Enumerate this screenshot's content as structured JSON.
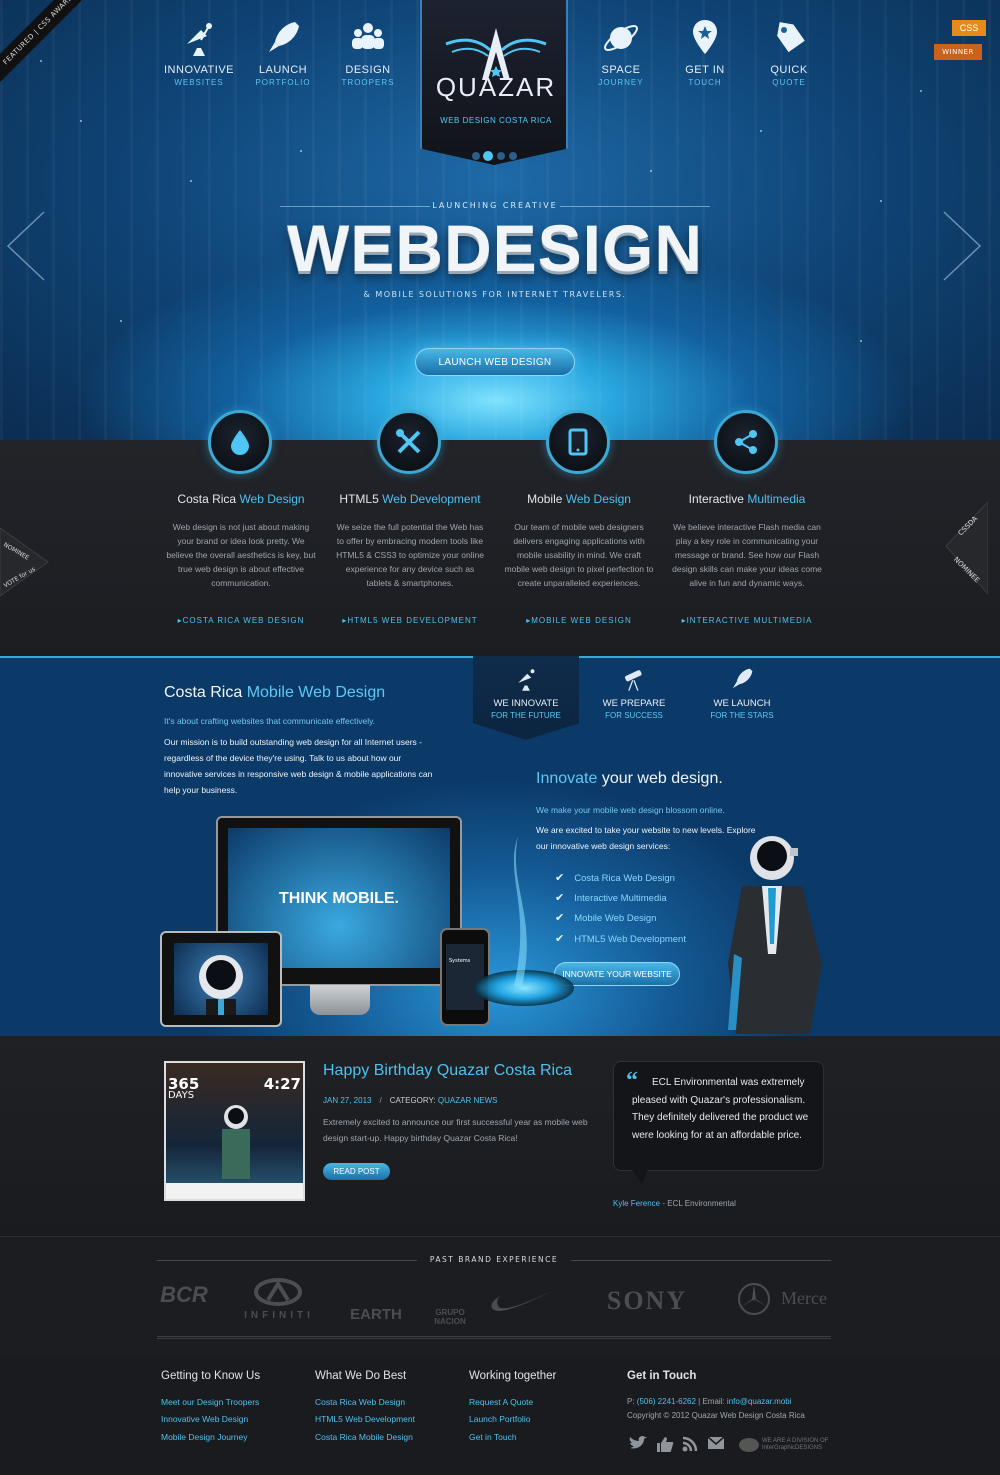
{
  "hero": {
    "ribbon": "FEATURED | CSS AWARDS",
    "badges": {
      "css": "CSS",
      "winner": "WINNER"
    },
    "nav_left": [
      {
        "label": "INNOVATIVE",
        "sub": "WEBSITES",
        "icon": "satellite-dish-icon"
      },
      {
        "label": "LAUNCH",
        "sub": "PORTFOLIO",
        "icon": "rocket-icon"
      },
      {
        "label": "DESIGN",
        "sub": "TROOPERS",
        "icon": "people-icon"
      }
    ],
    "nav_right": [
      {
        "label": "SPACE",
        "sub": "JOURNEY",
        "icon": "planet-icon"
      },
      {
        "label": "GET IN",
        "sub": "TOUCH",
        "icon": "map-pin-icon"
      },
      {
        "label": "QUICK",
        "sub": "QUOTE",
        "icon": "tag-icon"
      }
    ],
    "logo": {
      "brand": "QUAZAR",
      "sub": "WEB DESIGN COSTA RICA"
    },
    "kicker": "LAUNCHING CREATIVE",
    "headline": "WEBDESIGN",
    "tagline": "& MOBILE SOLUTIONS FOR INTERNET TRAVELERS.",
    "cta": "LAUNCH WEB DESIGN"
  },
  "services": [
    {
      "title_a": "Costa Rica ",
      "title_b": "Web Design",
      "icon": "drop-icon",
      "body": "Web design is not just about making your brand or idea look pretty. We believe the overall aesthetics is key, but true web design is about effective communication.",
      "link": "COSTA RICA WEB DESIGN"
    },
    {
      "title_a": "HTML5 ",
      "title_b": "Web Development",
      "icon": "tools-icon",
      "body": "We seize the full potential the Web has to offer by embracing modern tools like HTML5 & CSS3 to optimize your online experience for any device such as tablets & smartphones.",
      "link": "HTML5 WEB DEVELOPMENT"
    },
    {
      "title_a": "Mobile ",
      "title_b": "Web Design",
      "icon": "tablet-icon",
      "body": "Our team of mobile web designers delivers engaging applications with mobile usability in mind. We craft mobile web design to pixel perfection to create unparalleled experiences.",
      "link": "MOBILE WEB DESIGN"
    },
    {
      "title_a": "Interactive ",
      "title_b": "Multimedia",
      "icon": "share-icon",
      "body": "We believe interactive Flash media can play a key role in communicating your message or brand.  See how our Flash design skills can make your ideas come alive in fun and dynamic ways.",
      "link": "INTERACTIVE MULTIMEDIA"
    }
  ],
  "side_tags": {
    "left_1": "NOMINEE",
    "left_2": "VOTE for us",
    "right_1": "CSSDA",
    "right_2": "NOMINEE"
  },
  "mobile": {
    "title_a": "Costa Rica ",
    "title_b": "Mobile Web Design",
    "lead": "It's about crafting websites that communicate effectively.",
    "body": "Our mission is to build outstanding web design for all Internet users - regardless of the device they're using. Talk to us about how our innovative services in responsive web design & mobile applications can help your business.",
    "tabs": [
      {
        "l1": "WE INNOVATE",
        "l2": "FOR THE FUTURE",
        "icon": "satellite-dish-icon"
      },
      {
        "l1": "WE PREPARE",
        "l2": "FOR SUCCESS",
        "icon": "telescope-icon"
      },
      {
        "l1": "WE LAUNCH",
        "l2": "FOR THE STARS",
        "icon": "rocket-icon"
      }
    ],
    "innovate_a": "Innovate",
    "innovate_b": " your web design.",
    "innovate_lead": "We make your mobile web design blossom online.",
    "innovate_body": "We are excited to take your website to new levels. Explore our innovative web design services:",
    "checklist": [
      "Costa Rica Web Design",
      "Interactive Multimedia",
      "Mobile Web Design",
      "HTML5 Web Development"
    ],
    "cta": "INNOVATE YOUR WEBSITE",
    "screen_text": "THINK MOBILE.",
    "phone_text": "Systems"
  },
  "blog": {
    "img_365": "365",
    "img_days": "DAYS",
    "img_427": "4:27",
    "title": "Happy Birthday Quazar Costa Rica",
    "date": "JAN 27, 2013",
    "sep": "/",
    "cat_label": "CATEGORY: ",
    "category": "QUAZAR NEWS",
    "text": "Extremely excited to announce our first successful year as mobile web design start-up. Happy birthday Quazar Costa Rica!",
    "cta": "READ POST"
  },
  "testimonial": {
    "quote": "ECL Environmental was extremely pleased with Quazar's professionalism. They definitely delivered the product we were looking for at an affordable price.",
    "name": "Kyle Ference",
    "org": " - ECL Environmental"
  },
  "brands": {
    "title": "PAST BRAND EXPERIENCE",
    "logos": [
      "BCR",
      "INFINITI",
      "EARTH",
      "GRUPO NACION",
      "nike-swoosh",
      "SONY",
      "Merce"
    ]
  },
  "footer": {
    "cols": [
      {
        "title": "Getting to Know Us",
        "links": [
          "Meet our Design Troopers",
          "Innovative Web Design",
          "Mobile Design Journey"
        ]
      },
      {
        "title": "What We Do Best",
        "links": [
          "Costa Rica Web Design",
          "HTML5 Web Development",
          "Costa Rica Mobile Design"
        ]
      },
      {
        "title": "Working together",
        "links": [
          "Request A Quote",
          "Launch Portfolio",
          "Get in Touch"
        ]
      }
    ],
    "contact_title": "Get in Touch",
    "phone_label": "P: ",
    "phone": "(506) 2241-6262",
    "email_label": " | Email: ",
    "email": "info@quazar.mobi",
    "copyright": "Copyright © 2012 Quazar Web Design Costa Rica",
    "igd": "WE ARE A DIVISION OF InterGraphicDESIGNS"
  },
  "colors": {
    "accent": "#4fc0ef",
    "dark": "#1c1d21",
    "blue": "#0c3a68"
  }
}
